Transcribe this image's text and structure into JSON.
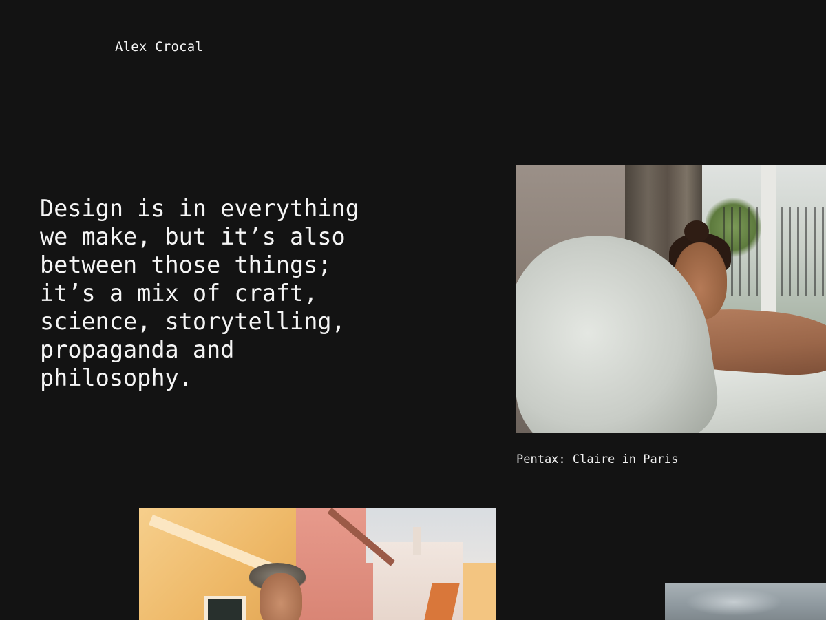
{
  "header": {
    "site_name": "Alex Crocal"
  },
  "hero": {
    "quote_lines": [
      "Design is in everything",
      "we make, but it’s also",
      "between those things;",
      "it’s a mix of craft,",
      "science, storytelling,",
      "propaganda and",
      "philosophy."
    ]
  },
  "gallery": {
    "items": [
      {
        "caption": "Pentax: Claire in Paris"
      }
    ]
  }
}
